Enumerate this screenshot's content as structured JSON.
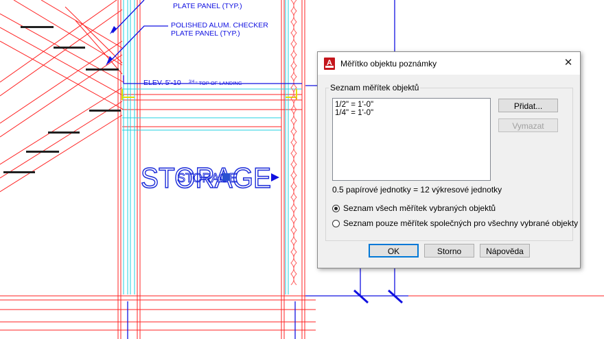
{
  "drawing": {
    "annotation1_line2": "PLATE PANEL (TYP.)",
    "annotation2_line1": "POLISHED ALUM. CHECKER",
    "annotation2_line2": "PLATE PANEL (TYP.)",
    "elevation_label": "ELEV. 5'-10",
    "elevation_fraction": "3/4",
    "elevation_suffix": "\" TOP OF LANDING",
    "room_label_large": "STORAGE",
    "room_label_small": "STORAGE"
  },
  "dialog": {
    "title": "Měřítko objektu poznámky",
    "close_glyph": "✕",
    "group_label": "Seznam měřítek objektů",
    "scales": [
      "1/2\" = 1'-0\"",
      "1/4\" = 1'-0\""
    ],
    "add_button": "Přidat...",
    "delete_button": "Vymazat",
    "ratio_text": "0.5 papírové jednotky = 12 výkresové jednotky",
    "radio_all": "Seznam všech měřítek vybraných objektů",
    "radio_common": "Seznam pouze měřítek společných pro všechny vybrané objekty",
    "radio_selected": "all",
    "ok_button": "OK",
    "cancel_button": "Storno",
    "help_button": "Nápověda"
  }
}
